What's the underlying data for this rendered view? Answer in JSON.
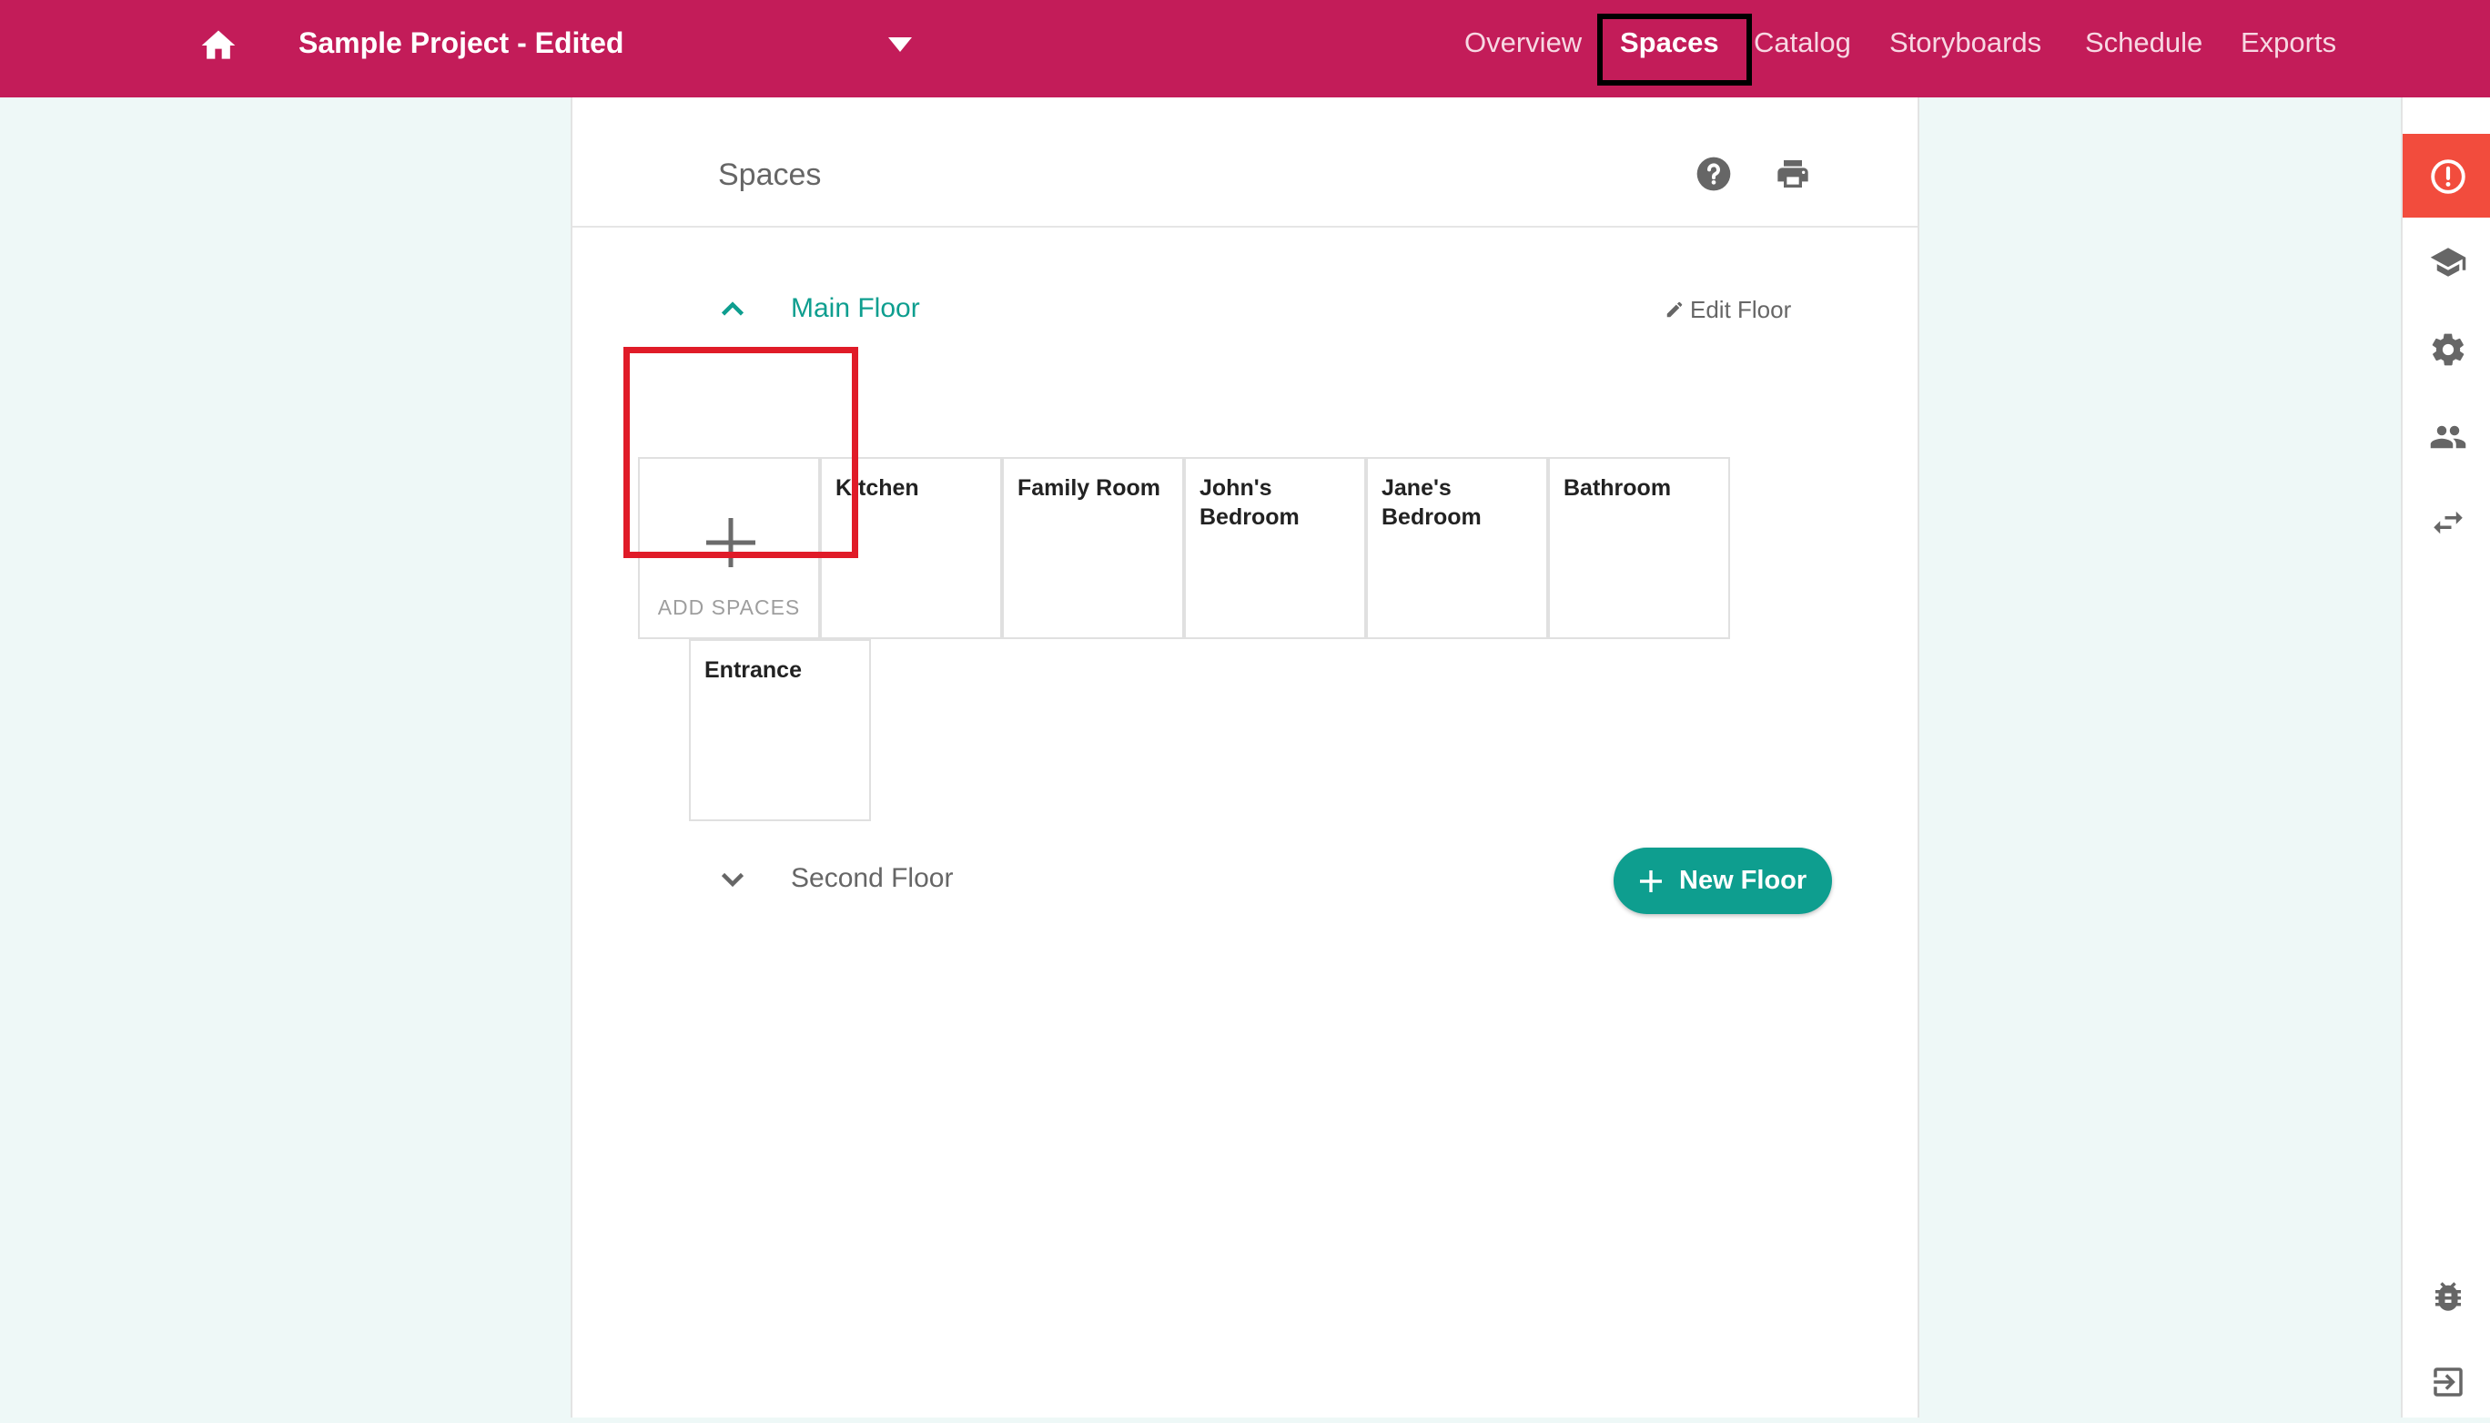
{
  "colors": {
    "brand": "#c31c59",
    "accent": "#0e9e8f",
    "alert": "#f24c3d",
    "highlight_red": "#e01b28"
  },
  "header": {
    "home_icon": "home-icon",
    "project_title": "Sample Project - Edited",
    "dropdown_icon": "caret-down-icon",
    "tabs": [
      {
        "label": "Overview",
        "active": false
      },
      {
        "label": "Spaces",
        "active": true
      },
      {
        "label": "Catalog",
        "active": false
      },
      {
        "label": "Storyboards",
        "active": false
      },
      {
        "label": "Schedule",
        "active": false
      },
      {
        "label": "Exports",
        "active": false
      }
    ]
  },
  "panel": {
    "title": "Spaces",
    "help_icon": "help-icon",
    "print_icon": "print-icon"
  },
  "floors": [
    {
      "name": "Main Floor",
      "expanded": true,
      "edit_label": "Edit Floor",
      "add_spaces_label": "ADD SPACES",
      "spaces": [
        "Kitchen",
        "Family Room",
        "John's Bedroom",
        "Jane's Bedroom",
        "Bathroom",
        "Entrance"
      ]
    },
    {
      "name": "Second Floor",
      "expanded": false
    }
  ],
  "new_floor_button": "New Floor",
  "rail": {
    "icons": [
      "alert-icon",
      "education-icon",
      "settings-icon",
      "people-icon",
      "swap-icon",
      "bug-icon",
      "exit-icon"
    ]
  }
}
